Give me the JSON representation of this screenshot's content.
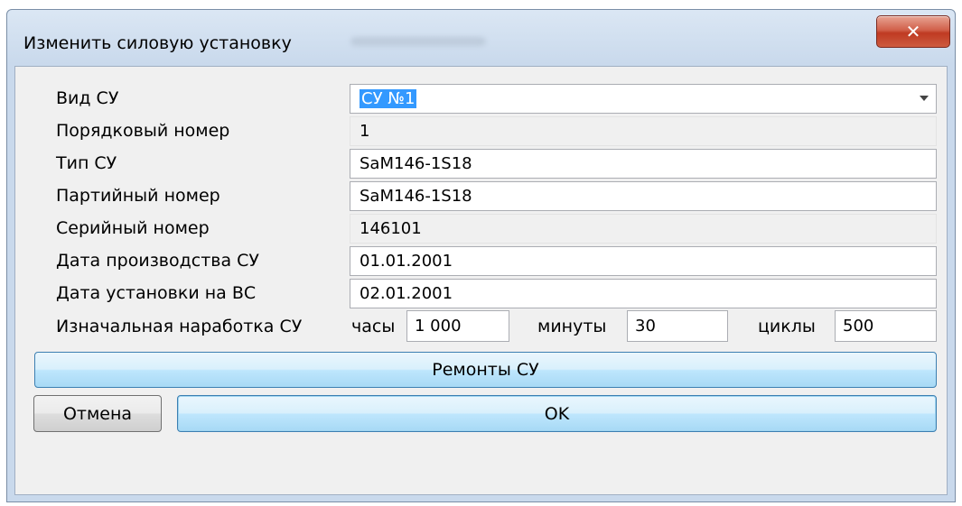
{
  "window": {
    "title": "Изменить силовую установку",
    "close_glyph": "✕"
  },
  "form": {
    "rows": [
      {
        "label": "Вид СУ",
        "value": "СУ №1",
        "kind": "combo"
      },
      {
        "label": "Порядковый номер",
        "value": "1",
        "kind": "readonly"
      },
      {
        "label": "Тип СУ",
        "value": "SaM146-1S18",
        "kind": "text"
      },
      {
        "label": "Партийный номер",
        "value": "SaM146-1S18",
        "kind": "text"
      },
      {
        "label": "Серийный номер",
        "value": "146101",
        "kind": "readonly"
      },
      {
        "label": "Дата производства СУ",
        "value": "01.01.2001",
        "kind": "text"
      },
      {
        "label": "Дата установки на ВС",
        "value": "02.01.2001",
        "kind": "text"
      }
    ],
    "initial_runtime": {
      "label": "Изначальная наработка СУ",
      "hours_label": "часы",
      "hours_value": "1 000",
      "minutes_label": "минуты",
      "minutes_value": "30",
      "cycles_label": "циклы",
      "cycles_value": "500"
    }
  },
  "buttons": {
    "repairs": "Ремонты СУ",
    "cancel": "Отмена",
    "ok": "OK"
  },
  "icons": {
    "close": "close-icon",
    "dropdown": "chevron-down-icon"
  }
}
